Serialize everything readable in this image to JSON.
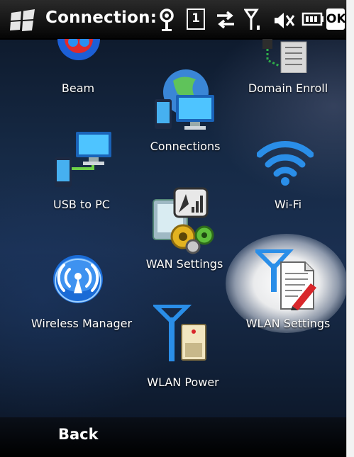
{
  "status_bar": {
    "title": "Connection:",
    "icons": [
      "windows-start-icon",
      "gps-icon",
      "sim-1-icon",
      "data-transfer-icon",
      "signal-icon",
      "volume-muted-icon",
      "battery-icon",
      "ok-button"
    ],
    "ok_label": "OK",
    "sim_label": "1"
  },
  "items": [
    {
      "label": "Beam",
      "icon": "beam-icon"
    },
    {
      "label": "Domain Enroll",
      "icon": "domain-enroll-icon"
    },
    {
      "label": "Connections",
      "icon": "connections-icon"
    },
    {
      "label": "USB to PC",
      "icon": "usb-to-pc-icon"
    },
    {
      "label": "Wi-Fi",
      "icon": "wifi-icon"
    },
    {
      "label": "WAN Settings",
      "icon": "wan-settings-icon"
    },
    {
      "label": "Wireless Manager",
      "icon": "wireless-manager-icon"
    },
    {
      "label": "WLAN Settings",
      "icon": "wlan-settings-icon",
      "selected": true
    },
    {
      "label": "WLAN Power",
      "icon": "wlan-power-icon"
    }
  ],
  "bottom_bar": {
    "back_label": "Back"
  },
  "colors": {
    "accent_blue": "#2a8ee8",
    "background": "#162a46",
    "bar": "#000000"
  }
}
